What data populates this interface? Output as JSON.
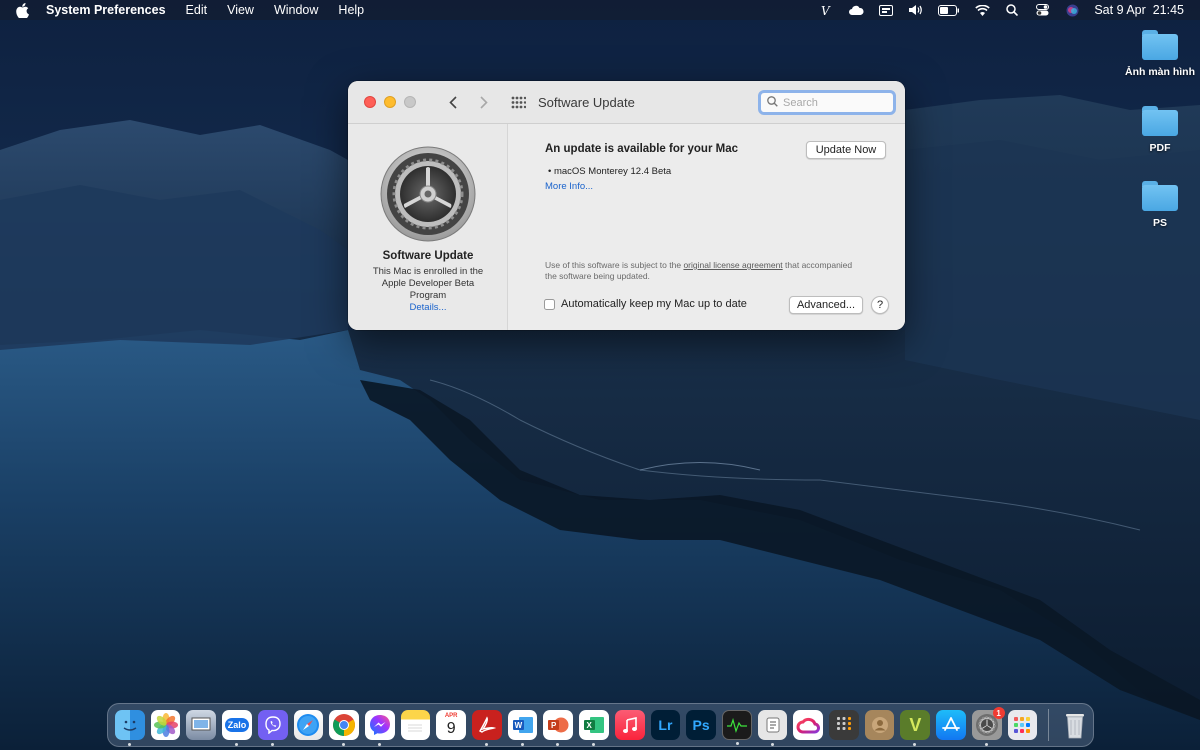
{
  "menubar": {
    "app_name": "System Preferences",
    "menus": [
      "Edit",
      "View",
      "Window",
      "Help"
    ],
    "clock": "Sat 9 Apr  21:45",
    "status_icons": [
      "viber-status-icon",
      "cloud-icon",
      "display-icon",
      "volume-icon",
      "battery-icon",
      "wifi-icon",
      "search-icon",
      "control-center-icon",
      "siri-icon"
    ]
  },
  "desktop": {
    "folders": [
      {
        "label": "Ảnh màn hình"
      },
      {
        "label": "PDF"
      },
      {
        "label": "PS"
      }
    ]
  },
  "window": {
    "title": "Software Update",
    "search_placeholder": "Search",
    "left": {
      "title": "Software Update",
      "description": "This Mac is enrolled in the Apple Developer Beta Program",
      "details_link": "Details..."
    },
    "right": {
      "update_title": "An update is available for your Mac",
      "update_item": "• macOS Monterey 12.4 Beta",
      "more_info": "More Info...",
      "update_now_label": "Update Now",
      "license_prefix": "Use of this software is subject to the ",
      "license_link": "original license agreement",
      "license_suffix": " that accompanied the software being updated.",
      "auto_update_label": "Automatically keep my Mac up to date",
      "auto_update_checked": false,
      "advanced_label": "Advanced...",
      "help_label": "?"
    }
  },
  "dock": {
    "calendar_month": "APR",
    "calendar_day": "9",
    "zalo_label": "Zalo",
    "lr_label": "Lr",
    "ps_label": "Ps",
    "v_label": "V",
    "prefs_badge": "1"
  }
}
